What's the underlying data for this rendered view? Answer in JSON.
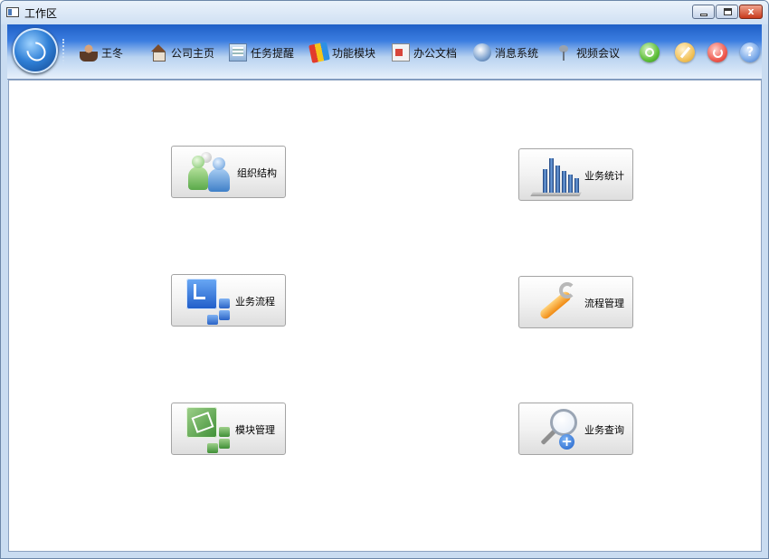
{
  "window": {
    "title": "工作区",
    "controls": {
      "minimize_icon": "minimize-icon",
      "maximize_icon": "maximize-icon",
      "close_icon": "close-icon",
      "close_glyph": "x"
    }
  },
  "toolbar": {
    "logo_icon": "app-orb-icon",
    "items": [
      {
        "label": "王冬",
        "icon": "user-icon"
      },
      {
        "label": "公司主页",
        "icon": "home-icon"
      },
      {
        "label": "任务提醒",
        "icon": "task-reminder-icon"
      },
      {
        "label": "功能模块",
        "icon": "modules-icon"
      },
      {
        "label": "办公文档",
        "icon": "document-icon"
      },
      {
        "label": "消息系统",
        "icon": "message-icon"
      },
      {
        "label": "视频会议",
        "icon": "video-meeting-icon"
      }
    ],
    "round_buttons": [
      {
        "icon": "search-icon",
        "color": "#5fbf3a"
      },
      {
        "icon": "edit-icon",
        "color": "#f2c35c"
      },
      {
        "icon": "power-icon",
        "color": "#ef5b50"
      },
      {
        "icon": "help-icon",
        "color": "#7aa9e8",
        "glyph": "?"
      }
    ]
  },
  "tiles": [
    {
      "label": "组织结构",
      "icon": "organization-icon"
    },
    {
      "label": "业务统计",
      "icon": "statistics-chart-icon"
    },
    {
      "label": "业务流程",
      "icon": "workflow-icon"
    },
    {
      "label": "流程管理",
      "icon": "wrench-icon"
    },
    {
      "label": "模块管理",
      "icon": "module-manage-icon"
    },
    {
      "label": "业务查询",
      "icon": "search-add-icon",
      "glyph": "+"
    }
  ]
}
